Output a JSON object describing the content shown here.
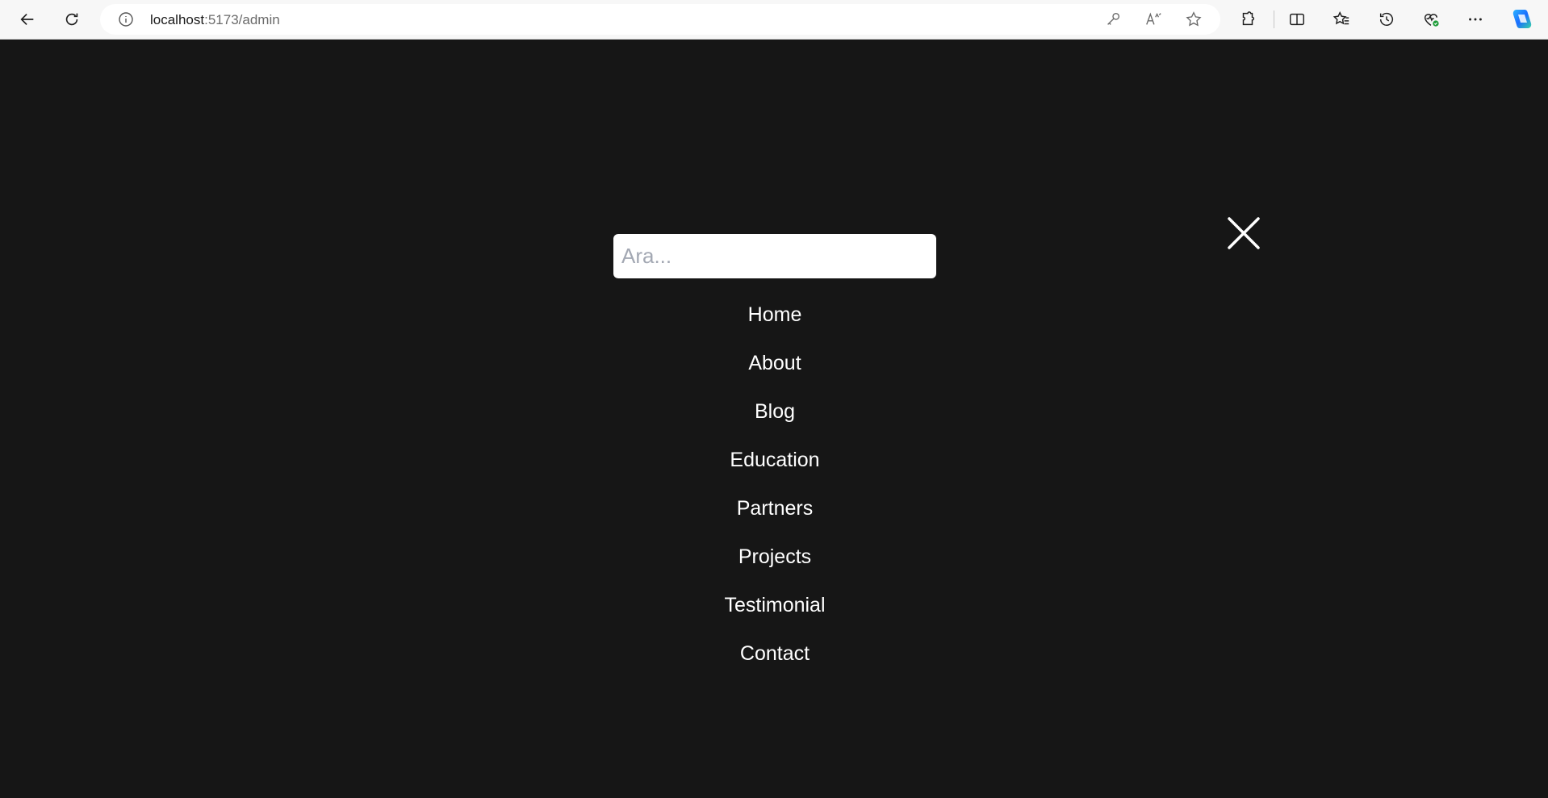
{
  "browser": {
    "url_host": "localhost",
    "url_path": ":5173/admin",
    "icons": [
      "back-arrow-icon",
      "refresh-icon",
      "info-icon",
      "key-icon",
      "read-aloud-icon",
      "favorite-star-icon",
      "extensions-icon",
      "split-screen-icon",
      "favorites-icon",
      "history-icon",
      "browser-essentials-icon",
      "more-icon",
      "copilot-icon"
    ]
  },
  "menu": {
    "search_placeholder": "Ara...",
    "items": [
      {
        "label": "Home"
      },
      {
        "label": "About"
      },
      {
        "label": "Blog"
      },
      {
        "label": "Education"
      },
      {
        "label": "Partners"
      },
      {
        "label": "Projects"
      },
      {
        "label": "Testimonial"
      },
      {
        "label": "Contact"
      }
    ]
  },
  "colors": {
    "page_background": "#161616",
    "text": "#ffffff",
    "input_background": "#ffffff",
    "placeholder": "#a3a8b3"
  }
}
